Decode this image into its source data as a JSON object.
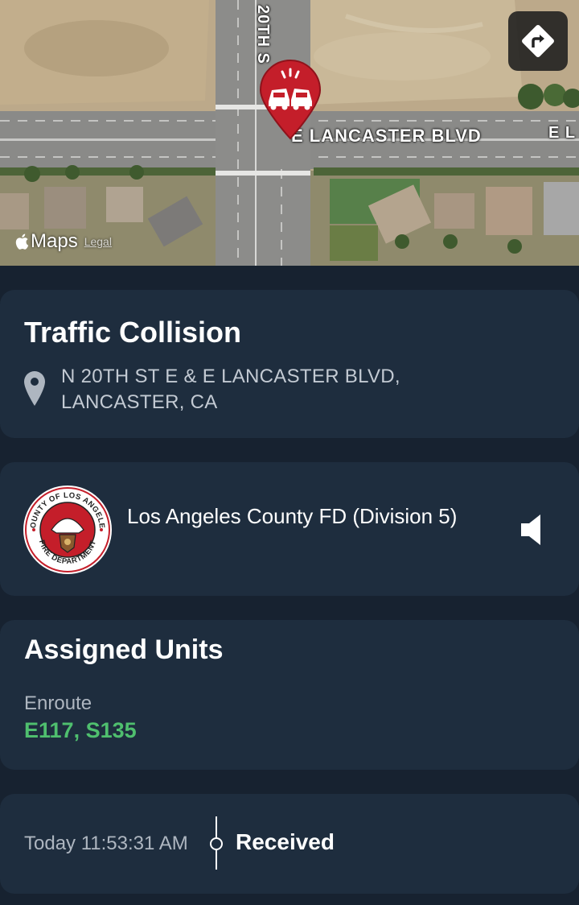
{
  "map": {
    "street_labels": {
      "lancaster": "E LANCASTER BLVD",
      "lancaster_cut": "E L",
      "twentieth": "20TH S"
    },
    "attribution": {
      "logo": "Maps",
      "legal": "Legal"
    },
    "icons": {
      "pin": "car-collision-pin-icon",
      "directions": "directions-icon"
    },
    "pin_color": "#c41e2a"
  },
  "incident": {
    "title": "Traffic Collision",
    "address": "N 20TH ST E & E LANCASTER BLVD, LANCASTER, CA",
    "icon": "location-pin-icon"
  },
  "agency": {
    "name": "Los Angeles County FD (Division 5)",
    "logo_text_top": "COUNTY OF LOS ANGELES",
    "logo_text_bottom": "FIRE DEPARTMENT",
    "icon": "speaker-icon"
  },
  "units": {
    "title": "Assigned Units",
    "status": "Enroute",
    "list": "E117, S135",
    "list_color": "#4fbf6e"
  },
  "timeline": {
    "time": "Today 11:53:31 AM",
    "label": "Received"
  },
  "colors": {
    "background": "#172230",
    "card": "#1e2d3e",
    "secondary_text": "#aeb6c0"
  }
}
